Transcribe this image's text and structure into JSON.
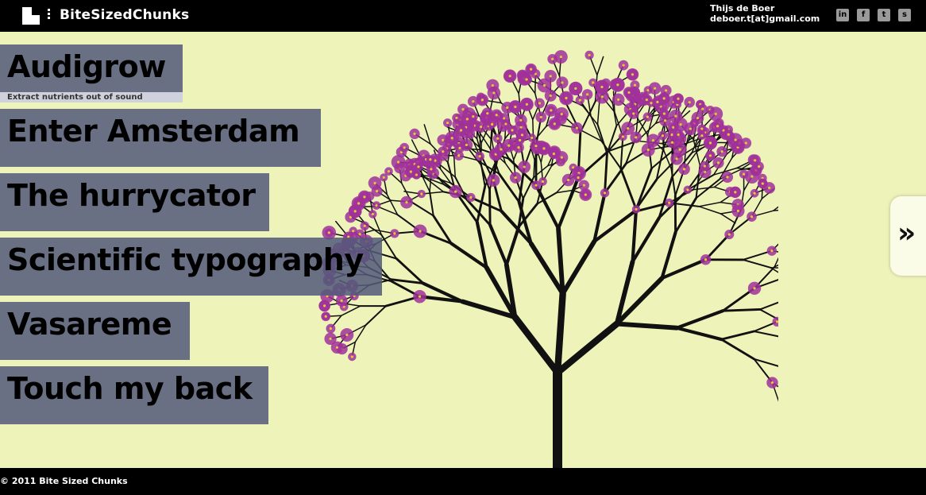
{
  "header": {
    "brand": "BiteSizedChunks",
    "contact_name": "Thijs de Boer",
    "contact_email": "deboer.t[at]gmail.com",
    "social": [
      {
        "icon": "linkedin-icon",
        "glyph": "in"
      },
      {
        "icon": "facebook-icon",
        "glyph": "f"
      },
      {
        "icon": "twitter-icon",
        "glyph": "t"
      },
      {
        "icon": "stumbleupon-icon",
        "glyph": "s"
      }
    ]
  },
  "projects": [
    {
      "title": "Audigrow",
      "subtitle": "Extract nutrients out of sound"
    },
    {
      "title": "Enter Amsterdam"
    },
    {
      "title": "The hurrycator"
    },
    {
      "title": "Scientific typography"
    },
    {
      "title": "Vasareme"
    },
    {
      "title": "Touch my back"
    }
  ],
  "next_glyph": "»",
  "footer": {
    "copyright": "© 2011 Bite Sized Chunks"
  },
  "colors": {
    "background": "#eef3b9",
    "bar": "#000000",
    "project_label": "#545a7a",
    "blossom": "#a0309a"
  }
}
